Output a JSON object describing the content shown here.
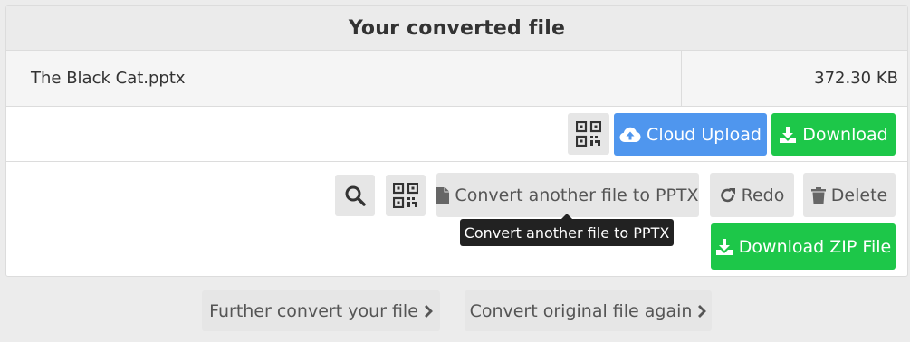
{
  "panel": {
    "title": "Your converted file",
    "file": {
      "name": "The Black Cat.pptx",
      "size": "372.30 KB"
    }
  },
  "actions": {
    "cloud_upload_label": "Cloud Upload",
    "download_label": "Download"
  },
  "tools": {
    "convert_another_label": "Convert another file to PPTX",
    "redo_label": "Redo",
    "delete_label": "Delete",
    "download_zip_label": "Download ZIP File",
    "tooltip": "Convert another file to PPTX"
  },
  "footer": {
    "further_convert_label": "Further convert your file",
    "convert_again_label": "Convert original file again"
  },
  "icons": {
    "qr": "qr-code-icon",
    "cloud": "cloud-upload-icon",
    "download": "download-icon",
    "search": "search-icon",
    "file": "file-icon",
    "redo": "redo-icon",
    "trash": "trash-icon",
    "chevron": "chevron-right-icon"
  },
  "colors": {
    "blue": "#4f96ee",
    "green": "#1dc749",
    "grey_button": "#e6e6e6",
    "tooltip": "#222222"
  }
}
